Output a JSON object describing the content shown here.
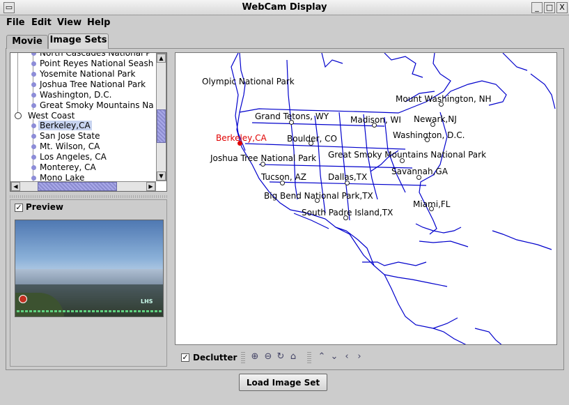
{
  "window": {
    "title": "WebCam Display",
    "controls": [
      "_",
      "□",
      "X"
    ]
  },
  "menu": {
    "items": [
      "File",
      "Edit",
      "View",
      "Help"
    ]
  },
  "tabs": [
    {
      "label": "Movie"
    },
    {
      "label": "Image Sets"
    }
  ],
  "tree": {
    "rows": [
      {
        "label": "North Cascades National P",
        "level": 2
      },
      {
        "label": "Point Reyes National Seash",
        "level": 2
      },
      {
        "label": "Yosemite National Park",
        "level": 2
      },
      {
        "label": "Joshua Tree National Park",
        "level": 2
      },
      {
        "label": "Washington, D.C.",
        "level": 2
      },
      {
        "label": "Great Smoky Mountains Na",
        "level": 2
      },
      {
        "label": "West Coast",
        "level": 1
      },
      {
        "label": "Berkeley,CA",
        "level": 2,
        "selected": true
      },
      {
        "label": "San Jose State",
        "level": 2
      },
      {
        "label": "Mt. Wilson, CA",
        "level": 2
      },
      {
        "label": "Los Angeles, CA",
        "level": 2
      },
      {
        "label": "Monterey, CA",
        "level": 2
      },
      {
        "label": "Mono Lake",
        "level": 2
      }
    ]
  },
  "preview": {
    "label": "Preview",
    "checked": true,
    "overlay_logo": "LHS"
  },
  "map": {
    "labels": [
      {
        "text": "Olympic National Park"
      },
      {
        "text": "Mount Washington, NH"
      },
      {
        "text": "Grand Tetons, WY"
      },
      {
        "text": "Madison, WI"
      },
      {
        "text": "Newark,NJ"
      },
      {
        "text": "Washington, D.C."
      },
      {
        "text": "Berkeley,CA",
        "highlight": true
      },
      {
        "text": "Boulder, CO"
      },
      {
        "text": "Joshua Tree National Park"
      },
      {
        "text": "Great Smoky Mountains National Park"
      },
      {
        "text": "Savannah,GA"
      },
      {
        "text": "Tucson, AZ"
      },
      {
        "text": "Dallas,TX"
      },
      {
        "text": "Big Bend National Park,TX"
      },
      {
        "text": "Miami,FL"
      },
      {
        "text": "South Padre Island,TX"
      }
    ],
    "highlight_color": "#e00000",
    "line_color": "#0000cc"
  },
  "toolbar": {
    "declutter_label": "Declutter",
    "declutter_checked": true,
    "tools": [
      "zoom-in-icon",
      "zoom-out-icon",
      "reset-zoom-icon",
      "home-icon",
      "pan-up-icon",
      "pan-down-icon",
      "pan-left-icon",
      "pan-right-icon"
    ]
  },
  "load_button": {
    "label": "Load Image Set"
  }
}
